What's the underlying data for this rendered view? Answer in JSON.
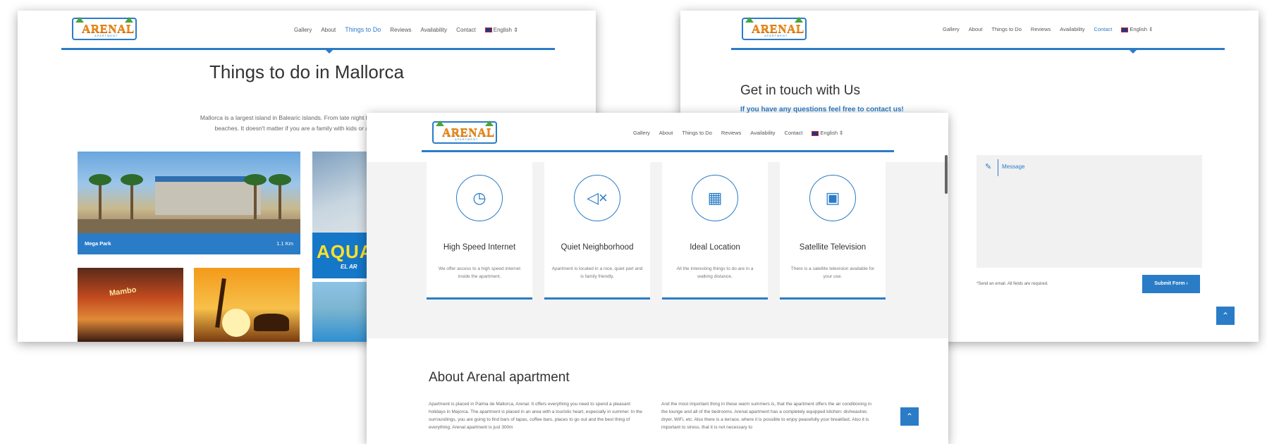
{
  "brand": {
    "logo_text": "ARENAL",
    "logo_sub": "APARTMENT"
  },
  "w1": {
    "nav": [
      "Gallery",
      "About",
      "Things to Do",
      "Reviews",
      "Availability",
      "Contact"
    ],
    "language": "English",
    "title": "Things to do in Mallorca",
    "intro_line1": "Mallorca is a largest island in Balearic islands. From late night bar crawls, riding water",
    "intro_line2": "beaches. It doesn't matter if you are a family with kids or a young by beach",
    "caption_name": "Mega Park",
    "caption_distance": "1.1 Km",
    "aqua_text": "AQUAL",
    "aqua_sub": "EL AR",
    "bar_sign": "Mambo"
  },
  "w2": {
    "nav": [
      "Gallery",
      "About",
      "Things to Do",
      "Reviews",
      "Availability",
      "Contact"
    ],
    "language": "English",
    "title": "Get in touch with Us",
    "subtitle": "If you have any questions feel free to contact us!",
    "message_label": "Message",
    "required_note": "*Send an email. All fields are required.",
    "submit_label": "Submit Form"
  },
  "w3": {
    "nav": [
      "Gallery",
      "About",
      "Things to Do",
      "Reviews",
      "Availability",
      "Contact"
    ],
    "language": "English",
    "features": [
      {
        "title": "High Speed Internet",
        "desc": "We offer access to a high speed internet inside the apartment.",
        "icon": "speedometer-icon"
      },
      {
        "title": "Quiet Neighborhood",
        "desc": "Apartment is located in a nice, quiet part and is family friendly.",
        "icon": "mute-speaker-icon"
      },
      {
        "title": "Ideal Location",
        "desc": "All the interesting things to do are in a walking distance.",
        "icon": "map-icon"
      },
      {
        "title": "Satellite Television",
        "desc": "There is a satellite television available for your use.",
        "icon": "monitor-icon"
      }
    ],
    "about_title": "About Arenal apartment",
    "about_p1": "Apartment is placed in Palma de Mallorca, Arenal. It offers everything you need to spend a pleasant holidays in Majorca. The apartment is placed in an area with a touristic heart, especially in summer. In the surroundings, you are going to find bars of tapas, coffee bars, places to go out and the best thing of everything. Arenal apartment is just 300m",
    "about_p2": "And the most important thing in these warm summers is, that the apartment offers the air conditioning in the lounge and all of the bedrooms. Arenal apartment has a completely equipped kitchen: dishwasher, dryer, WiFi, etc. Also there is a terrace, where it is possible to enjoy peacefully your breakfast. Also it is important to stress, that it is not necessary to"
  },
  "icons": {
    "scroll_top": "chevron-up-icon",
    "caret": "caret-down-icon"
  },
  "colors": {
    "accent": "#2a7cc7",
    "logo": "#e88a1a"
  }
}
